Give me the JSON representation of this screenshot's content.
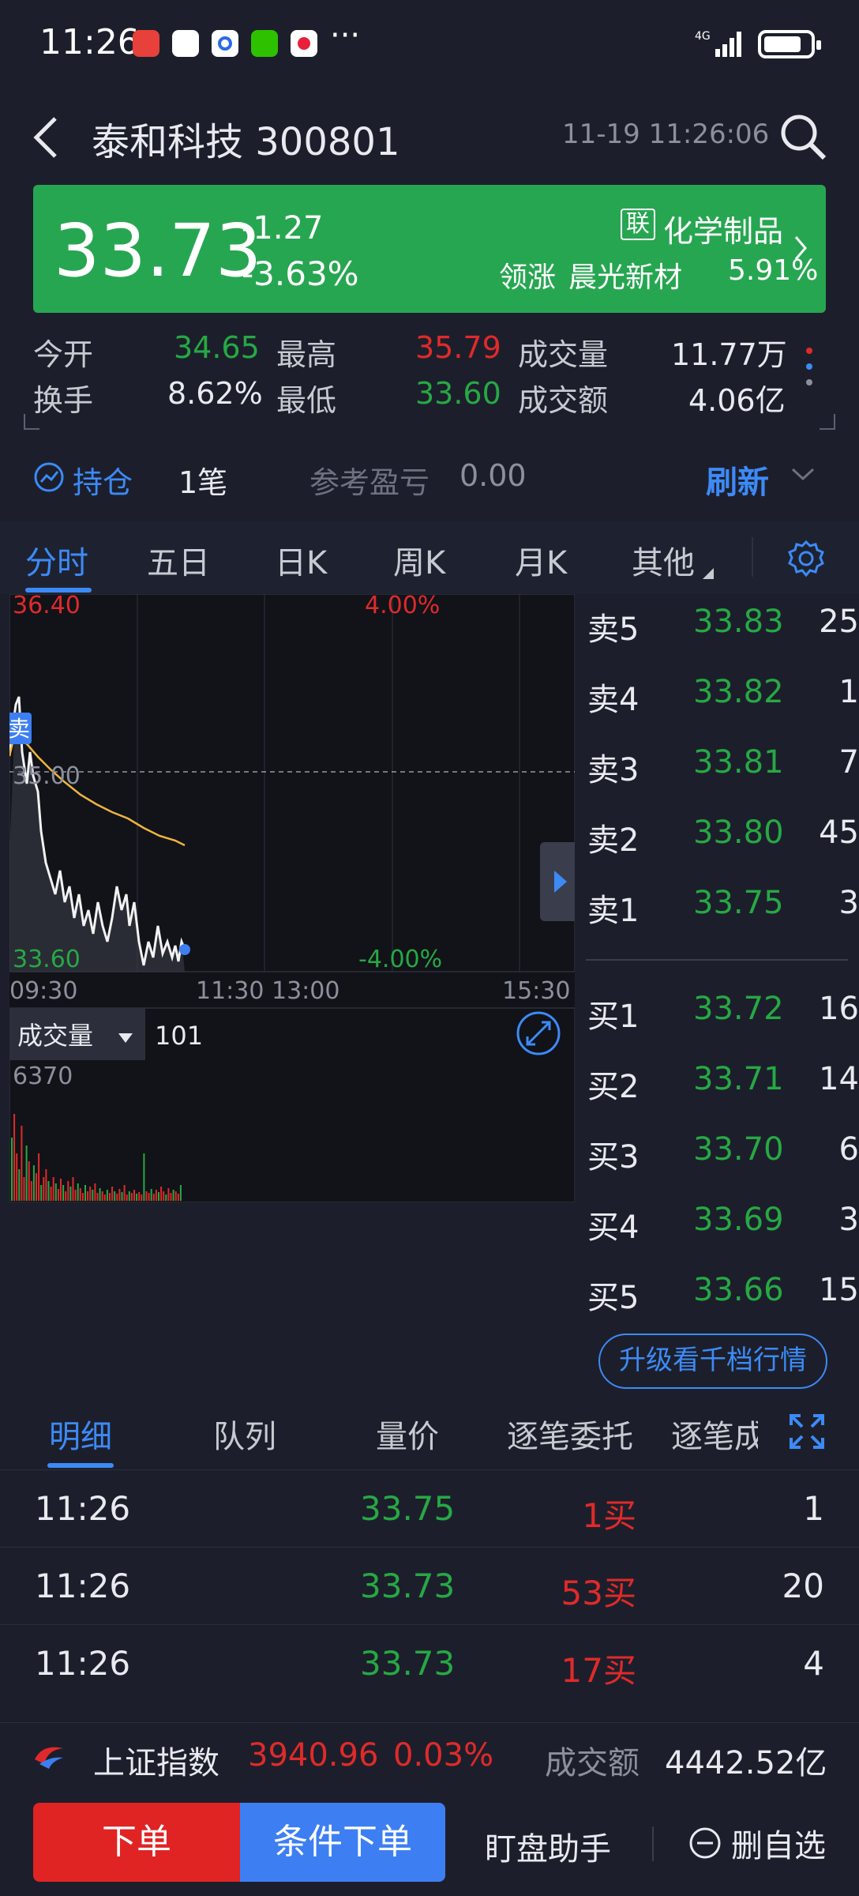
{
  "status": {
    "time": "11:26",
    "dots": "···",
    "net": "4G"
  },
  "header": {
    "title": "泰和科技 300801",
    "datetime": "11-19 11:26:06"
  },
  "banner": {
    "price": "33.73",
    "change": "-1.27",
    "pct": "-3.63%",
    "tag": "联",
    "sector": "化学制品",
    "lead_label": "领涨",
    "lead_stock": "晨光新材",
    "lead_pct": "5.91%"
  },
  "stats": [
    {
      "label": "今开",
      "value": "34.65",
      "color": "#27a844"
    },
    {
      "label": "最高",
      "value": "35.79",
      "color": "#e02a2a"
    },
    {
      "label": "成交量",
      "value": "11.77万",
      "color": "#e8eaf0"
    },
    {
      "label": "换手",
      "value": "8.62%",
      "color": "#e8eaf0"
    },
    {
      "label": "最低",
      "value": "33.60",
      "color": "#27a844"
    },
    {
      "label": "成交额",
      "value": "4.06亿",
      "color": "#e8eaf0"
    }
  ],
  "position": {
    "label": "持仓",
    "count": "1笔",
    "pl_label": "参考盈亏",
    "pl_value": "0.00",
    "refresh": "刷新"
  },
  "chart_tabs": [
    "分时",
    "五日",
    "日K",
    "周K",
    "月K",
    "其他"
  ],
  "chart": {
    "price_high": "36.40",
    "price_mid": "35.00",
    "price_low": "33.60",
    "pct_high": "4.00%",
    "pct_low": "-4.00%",
    "times": [
      "09:30",
      "11:30",
      "13:00",
      "15:30"
    ],
    "sell_marker": "卖",
    "volume_label": "成交量",
    "volume_value": "101",
    "volume_max": "6370"
  },
  "order_book": {
    "asks": [
      {
        "label": "卖5",
        "price": "33.83",
        "vol": "25"
      },
      {
        "label": "卖4",
        "price": "33.82",
        "vol": "1"
      },
      {
        "label": "卖3",
        "price": "33.81",
        "vol": "7"
      },
      {
        "label": "卖2",
        "price": "33.80",
        "vol": "45"
      },
      {
        "label": "卖1",
        "price": "33.75",
        "vol": "3"
      }
    ],
    "bids": [
      {
        "label": "买1",
        "price": "33.72",
        "vol": "16"
      },
      {
        "label": "买2",
        "price": "33.71",
        "vol": "14"
      },
      {
        "label": "买3",
        "price": "33.70",
        "vol": "6"
      },
      {
        "label": "买4",
        "price": "33.69",
        "vol": "3"
      },
      {
        "label": "买5",
        "price": "33.66",
        "vol": "15"
      }
    ],
    "upgrade": "升级看千档行情"
  },
  "detail_tabs": [
    "明细",
    "队列",
    "量价",
    "逐笔委托",
    "逐笔成"
  ],
  "trades": [
    {
      "time": "11:26",
      "price": "33.75",
      "side": "1买",
      "vol": "1"
    },
    {
      "time": "11:26",
      "price": "33.73",
      "side": "53买",
      "vol": "20"
    },
    {
      "time": "11:26",
      "price": "33.73",
      "side": "17买",
      "vol": "4"
    }
  ],
  "index_bar": {
    "name": "上证指数",
    "value": "3940.96",
    "pct": "0.03%",
    "turnover_label": "成交额",
    "turnover_value": "4442.52亿"
  },
  "actions": {
    "order": "下单",
    "conditional": "条件下单",
    "monitor": "盯盘助手",
    "remove": "删自选"
  }
}
